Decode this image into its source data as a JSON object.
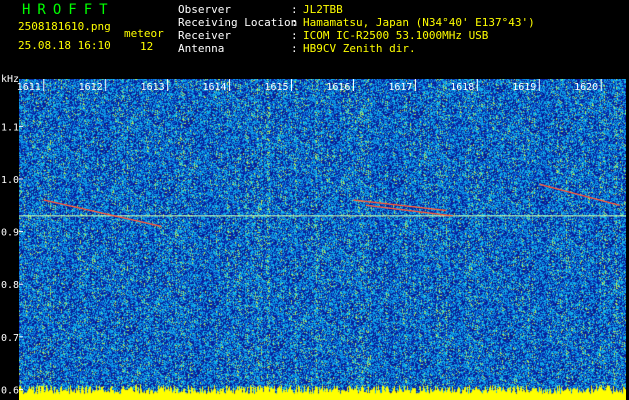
{
  "header": {
    "brand": "HROFFT",
    "filename": "2508181610.png",
    "datetime": "25.08.18 16:10",
    "meteor_label": "meteor",
    "meteor_count": "12",
    "info": [
      {
        "label": "Observer",
        "value": "JL2TBB"
      },
      {
        "label": "Receiving Location",
        "value": "Hamamatsu, Japan (N34°40' E137°43')"
      },
      {
        "label": "Receiver",
        "value": "ICOM IC-R2500 53.1000MHz USB"
      },
      {
        "label": "Antenna",
        "value": "HB9CV Zenith dir."
      }
    ],
    "colon": ":"
  },
  "colors": {
    "background": "#000000",
    "header_text": "#00ff00",
    "value_text": "#ffff00",
    "label_text": "#ffffff",
    "spectrum_low": "#0a1f9e",
    "spectrum_mid": "#1fa3ff",
    "spectrum_high": "#e6ff3a",
    "noise_band": "#ffff00"
  },
  "chart_data": {
    "type": "heatmap",
    "ylabel": "kHz",
    "ylim": [
      0.58,
      1.19
    ],
    "y_ticks": [
      "1.1",
      "1.0",
      "0.9",
      "0.8",
      "0.7",
      "0.6"
    ],
    "y_tick_values": [
      1.1,
      1.0,
      0.9,
      0.8,
      0.7,
      0.6
    ],
    "x_ticks": [
      "1611",
      "1612",
      "1613",
      "1614",
      "1615",
      "1616",
      "1617",
      "1618",
      "1619",
      "1620"
    ],
    "x_tick_values": [
      1611,
      1612,
      1613,
      1614,
      1615,
      1616,
      1617,
      1618,
      1619,
      1620
    ],
    "xlim": [
      1610.6,
      1620.4
    ],
    "carrier_khz": 0.93,
    "meteor_traces": [
      {
        "x0": 1611.0,
        "y0": 0.96,
        "x1": 1612.9,
        "y1": 0.91
      },
      {
        "x0": 1616.0,
        "y0": 0.96,
        "x1": 1617.5,
        "y1": 0.94
      },
      {
        "x0": 1616.2,
        "y0": 0.95,
        "x1": 1617.6,
        "y1": 0.93
      },
      {
        "x0": 1619.0,
        "y0": 0.99,
        "x1": 1620.3,
        "y1": 0.95
      }
    ]
  }
}
